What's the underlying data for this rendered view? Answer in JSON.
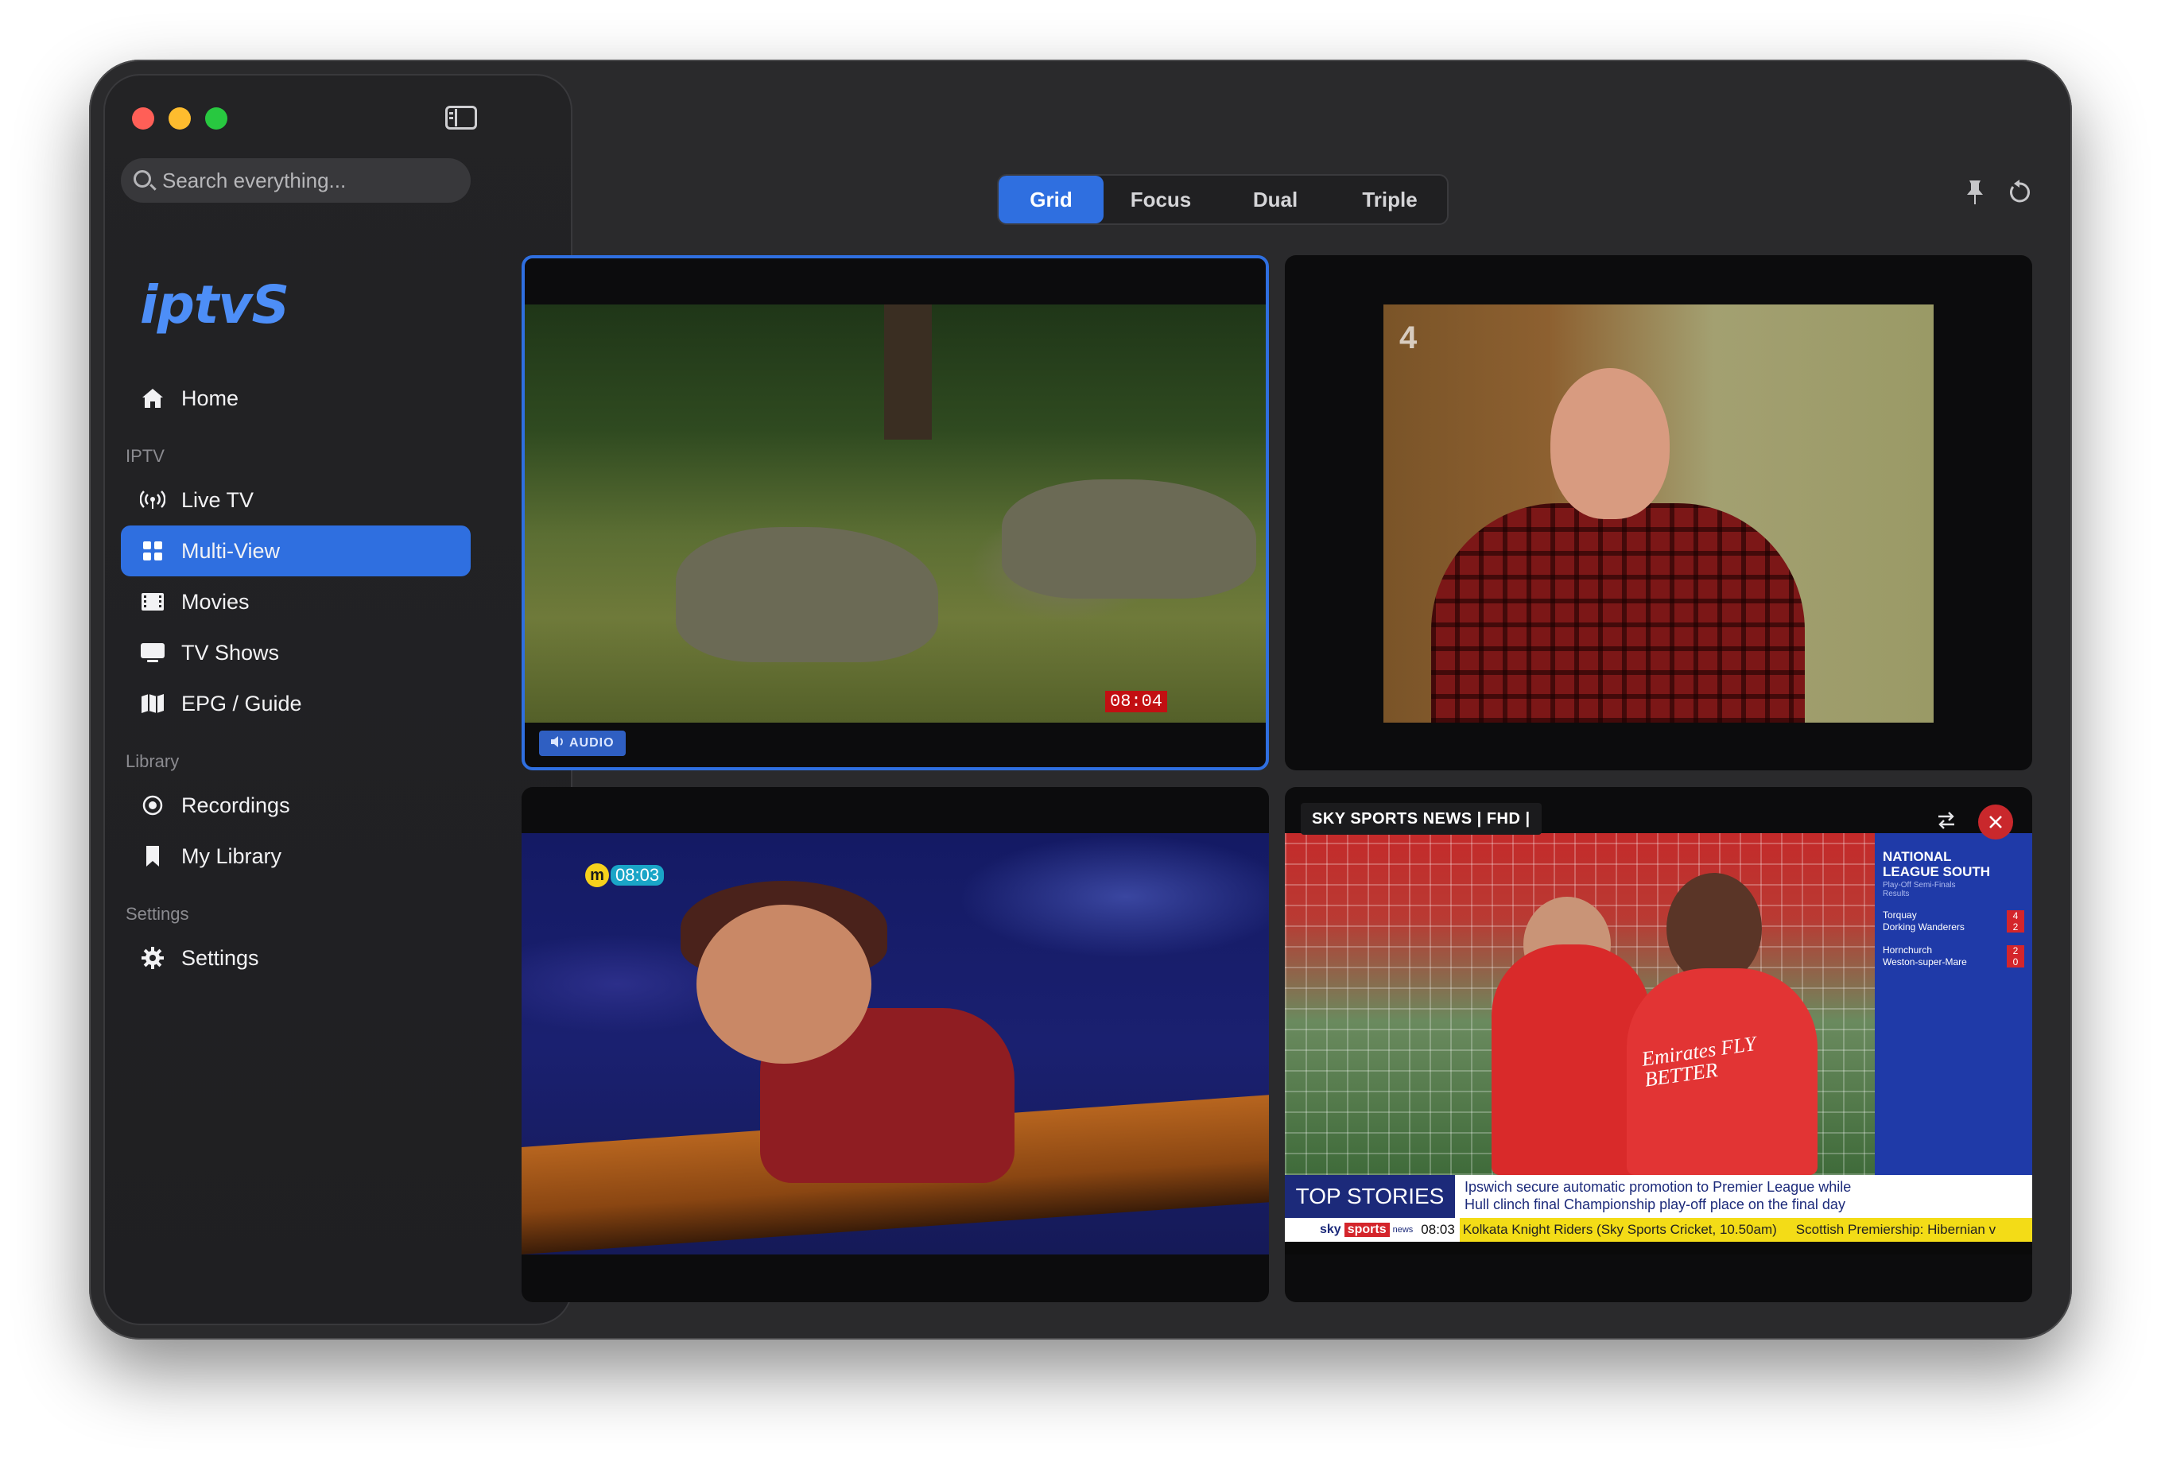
{
  "sidebar": {
    "search_placeholder": "Search everything...",
    "logo": "iptvS",
    "home_label": "Home",
    "sections": {
      "iptv": "IPTV",
      "library": "Library",
      "settings": "Settings"
    },
    "items": {
      "live_tv": "Live TV",
      "multi_view": "Multi-View",
      "movies": "Movies",
      "tv_shows": "TV Shows",
      "epg": "EPG / Guide",
      "recordings": "Recordings",
      "my_library": "My Library",
      "settings": "Settings"
    },
    "active_item": "Multi-View"
  },
  "layout_tabs": [
    "Grid",
    "Focus",
    "Dual",
    "Triple"
  ],
  "active_layout": "Grid",
  "tiles": [
    {
      "timestamp": "08:04",
      "audio_label": "AUDIO",
      "selected": true
    },
    {
      "channel_logo": "4",
      "selected": false
    },
    {
      "clock_logo": "m",
      "clock_time": "08:03",
      "selected": false
    },
    {
      "channel_label": "SKY SPORTS NEWS | FHD |",
      "selected": false,
      "side_panel": {
        "title_line1": "NATIONAL",
        "title_line2": "LEAGUE SOUTH",
        "subtitle_line1": "Play-Off Semi-Finals",
        "subtitle_line2": "Results",
        "results": [
          {
            "team1": "Torquay",
            "team2": "Dorking Wanderers",
            "score1": "4",
            "score2": "2"
          },
          {
            "team1": "Hornchurch",
            "team2": "Weston-super-Mare",
            "score1": "2",
            "score2": "0"
          }
        ]
      },
      "kit_sponsor": "Emirates FLY BETTER",
      "ticker": {
        "label": "TOP STORIES",
        "headline_line1": "Ipswich secure automatic promotion to Premier League while",
        "headline_line2": "Hull clinch final Championship play-off place on the final day",
        "brand_sky": "sky",
        "brand_sports": "sports",
        "brand_news": "news",
        "time": "08:03",
        "crawl1": "Kolkata Knight Riders (Sky Sports Cricket, 10.50am)",
        "crawl2": "Scottish Premiership: Hibernian v"
      }
    }
  ],
  "colors": {
    "accent": "#2f6fe0",
    "logo": "#4d8ef7",
    "window_bg": "#2a2a2c",
    "sidebar_bg": "#232325",
    "close_red": "#c9282c"
  },
  "icons": {
    "home": "house-icon",
    "live_tv": "antenna-icon",
    "multi_view": "grid-icon",
    "movies": "film-icon",
    "tv_shows": "tv-icon",
    "epg": "map-icon",
    "recordings": "record-icon",
    "my_library": "bookmark-icon",
    "settings": "gear-icon",
    "pin": "pin-icon",
    "reset": "reset-icon"
  }
}
